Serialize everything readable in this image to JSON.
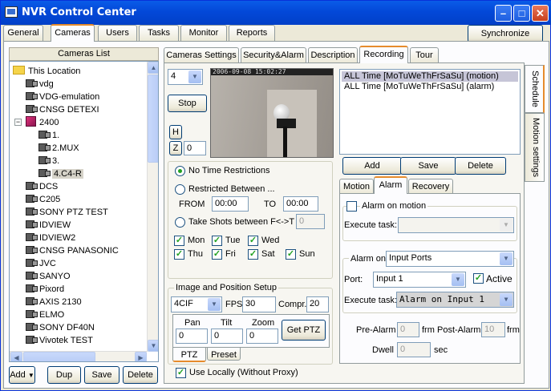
{
  "window": {
    "title": "NVR Control Center"
  },
  "main_tabs": [
    "General",
    "Cameras",
    "Users",
    "Tasks",
    "Monitor",
    "Reports"
  ],
  "sync_label": "Synchronize",
  "cameras_list": {
    "header": "Cameras List",
    "items": [
      {
        "label": "This Location",
        "level": 0,
        "icon": "folder-icon"
      },
      {
        "label": "vdg",
        "level": 1,
        "icon": "camera-icon"
      },
      {
        "label": "VDG-emulation",
        "level": 1,
        "icon": "camera-icon"
      },
      {
        "label": "CNSG DETEXI",
        "level": 1,
        "icon": "camera-icon"
      },
      {
        "label": "2400",
        "level": 1,
        "icon": "server-icon",
        "expander": "−"
      },
      {
        "label": "1.",
        "level": 2,
        "icon": "camera-icon"
      },
      {
        "label": "2.MUX",
        "level": 2,
        "icon": "camera-icon"
      },
      {
        "label": "3.",
        "level": 2,
        "icon": "camera-icon"
      },
      {
        "label": "4.C4-R",
        "level": 2,
        "icon": "camera-icon",
        "selected": true
      },
      {
        "label": "DCS",
        "level": 1,
        "icon": "camera-icon"
      },
      {
        "label": "C205",
        "level": 1,
        "icon": "camera-icon"
      },
      {
        "label": "SONY PTZ TEST",
        "level": 1,
        "icon": "camera-icon"
      },
      {
        "label": "IDVIEW",
        "level": 1,
        "icon": "camera-icon"
      },
      {
        "label": "IDVIEW2",
        "level": 1,
        "icon": "camera-icon"
      },
      {
        "label": "CNSG PANASONIC",
        "level": 1,
        "icon": "camera-icon"
      },
      {
        "label": "JVC",
        "level": 1,
        "icon": "camera-icon"
      },
      {
        "label": "SANYO",
        "level": 1,
        "icon": "camera-icon"
      },
      {
        "label": "Pixord",
        "level": 1,
        "icon": "camera-icon"
      },
      {
        "label": "AXIS 2130",
        "level": 1,
        "icon": "camera-icon"
      },
      {
        "label": "ELMO",
        "level": 1,
        "icon": "camera-icon"
      },
      {
        "label": "SONY DF40N",
        "level": 1,
        "icon": "camera-icon"
      },
      {
        "label": "Vivotek TEST",
        "level": 1,
        "icon": "camera-icon"
      }
    ],
    "buttons": {
      "add": "Add",
      "dup": "Dup",
      "save": "Save",
      "delete": "Delete"
    }
  },
  "camera_tabs": [
    "Cameras Settings",
    "Security&Alarm",
    "Description",
    "Recording",
    "Tour"
  ],
  "preview": {
    "channel": "4",
    "stop": "Stop",
    "h": "H",
    "z": "Z",
    "z_value": "0",
    "overlay_text": "2006-09-08 15:02:27"
  },
  "time": {
    "no_restrictions": "No Time Restrictions",
    "restricted_between": "Restricted Between ...",
    "from_label": "FROM",
    "from_value": "00:00",
    "to_label": "TO",
    "to_value": "00:00",
    "take_shots": "Take Shots between F<->T",
    "shots_value": "0",
    "days": [
      "Mon",
      "Tue",
      "Wed",
      "Thu",
      "Fri",
      "Sat",
      "Sun"
    ]
  },
  "image_setup": {
    "title": "Image and Position Setup",
    "resolution": "4CIF",
    "fps_label": "FPS",
    "fps_value": "30",
    "compr_label": "Compr.",
    "compr_value": "20",
    "pan_label": "Pan",
    "pan_value": "0",
    "tilt_label": "Tilt",
    "tilt_value": "0",
    "zoom_label": "Zoom",
    "zoom_value": "0",
    "get_ptz": "Get PTZ",
    "ptz_tab": "PTZ",
    "preset_tab": "Preset"
  },
  "use_locally": "Use Locally (Without Proxy)",
  "schedule": {
    "items": [
      "ALL Time [MoTuWeThFrSaSu] (motion)",
      "ALL Time [MoTuWeThFrSaSu] (alarm)"
    ],
    "add": "Add",
    "save": "Save",
    "delete": "Delete"
  },
  "side_tabs": [
    "Schedule",
    "Motion settings"
  ],
  "alarm_tabs": [
    "Motion",
    "Alarm",
    "Recovery"
  ],
  "alarm": {
    "alarm_on_motion": "Alarm on motion",
    "execute_task": "Execute task:",
    "alarm_on_label": "Alarm on",
    "alarm_on_value": "Input Ports",
    "port_label": "Port:",
    "port_value": "Input 1",
    "active_label": "Active",
    "execute_task2": "Execute task:",
    "execute_value": "Alarm on Input 1",
    "pre_alarm_label": "Pre-Alarm",
    "pre_alarm_value": "0",
    "frm1": "frm",
    "post_alarm_label": "Post-Alarm",
    "post_alarm_value": "10",
    "frm2": "frm",
    "dwell_label": "Dwell",
    "dwell_value": "0",
    "sec": "sec"
  }
}
